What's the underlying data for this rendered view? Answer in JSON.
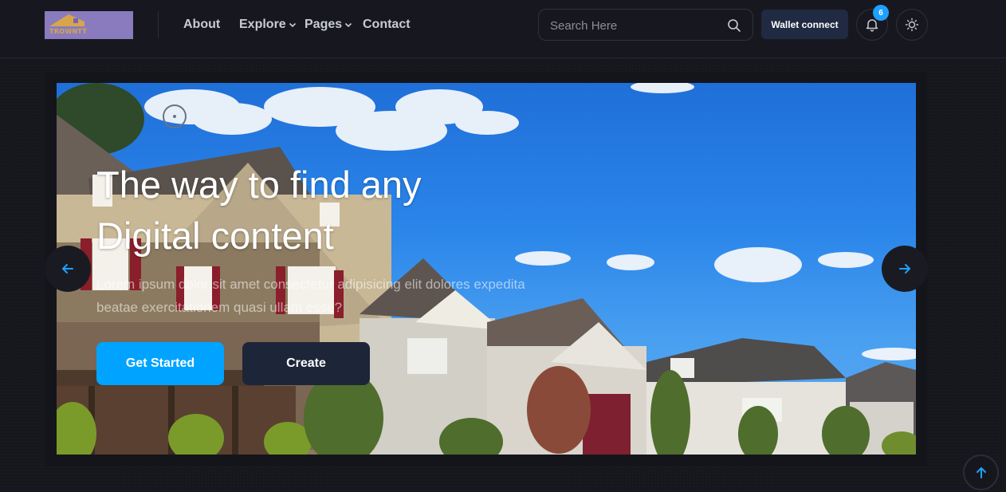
{
  "header": {
    "logo_text": "TROWNTT",
    "nav": [
      {
        "label": "About",
        "has_dropdown": false
      },
      {
        "label": "Explore",
        "has_dropdown": true
      },
      {
        "label": "Pages",
        "has_dropdown": true
      },
      {
        "label": "Contact",
        "has_dropdown": false
      }
    ],
    "search": {
      "placeholder": "Search Here",
      "icon": "search-icon"
    },
    "wallet_label": "Wallet connect",
    "notification_count": "6",
    "icons": {
      "notifications": "bell-icon",
      "theme": "sun-icon"
    }
  },
  "hero": {
    "title": "The way to find any Digital content",
    "subtitle": "Lorem ipsum dolor sit amet consectetur adipisicing elit dolores expedita beatae exercitationem quasi ullam esse?",
    "primary_button": "Get Started",
    "secondary_button": "Create",
    "prev_icon": "arrow-left-icon",
    "next_icon": "arrow-right-icon"
  },
  "colors": {
    "accent": "#00a3ff",
    "background": "#16171d",
    "header_bg": "#17181f",
    "dark_button": "#1d2539",
    "badge": "#1ea0ff"
  },
  "scroll_top_icon": "arrow-up-icon"
}
